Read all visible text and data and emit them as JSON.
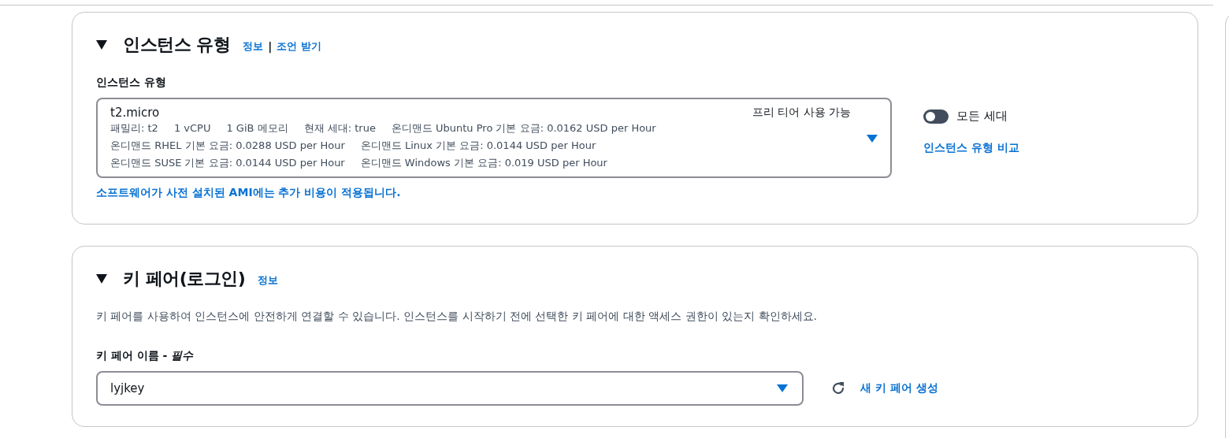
{
  "instance_type_section": {
    "title": "인스턴스 유형",
    "expanded": true,
    "links": [
      "정보",
      "조언 받기"
    ],
    "link_separator": "|",
    "field_label": "인스턴스 유형",
    "select": {
      "value": "t2.micro",
      "badge": "프리 티어 사용 가능",
      "detail_rows": [
        [
          "패밀리: t2",
          "1 vCPU",
          "1 GiB 메모리",
          "현재 세대: true",
          "온디맨드 Ubuntu Pro 기본 요금: 0.0162 USD per Hour"
        ],
        [
          "온디맨드 RHEL 기본 요금: 0.0288 USD per Hour",
          "온디맨드 Linux 기본 요금: 0.0144 USD per Hour"
        ],
        [
          "온디맨드 SUSE 기본 요금: 0.0144 USD per Hour",
          "온디맨드 Windows 기본 요금: 0.019 USD per Hour"
        ]
      ]
    },
    "toggle": {
      "label": "모든 세대",
      "on": false
    },
    "compare_link": "인스턴스 유형 비교",
    "note": "소프트웨어가 사전 설치된 AMI에는 추가 비용이 적용됩니다."
  },
  "key_pair_section": {
    "title": "키 페어(로그인)",
    "expanded": true,
    "links": [
      "정보"
    ],
    "description": "키 페어를 사용하여 인스턴스에 안전하게 연결할 수 있습니다. 인스턴스를 시작하기 전에 선택한 키 페어에 대한 액세스 권한이 있는지 확인하세요.",
    "field_label": "키 페어 이름 - *필수*",
    "select": {
      "value": "lyjkey"
    },
    "create_link": "새 키 페어 생성"
  }
}
